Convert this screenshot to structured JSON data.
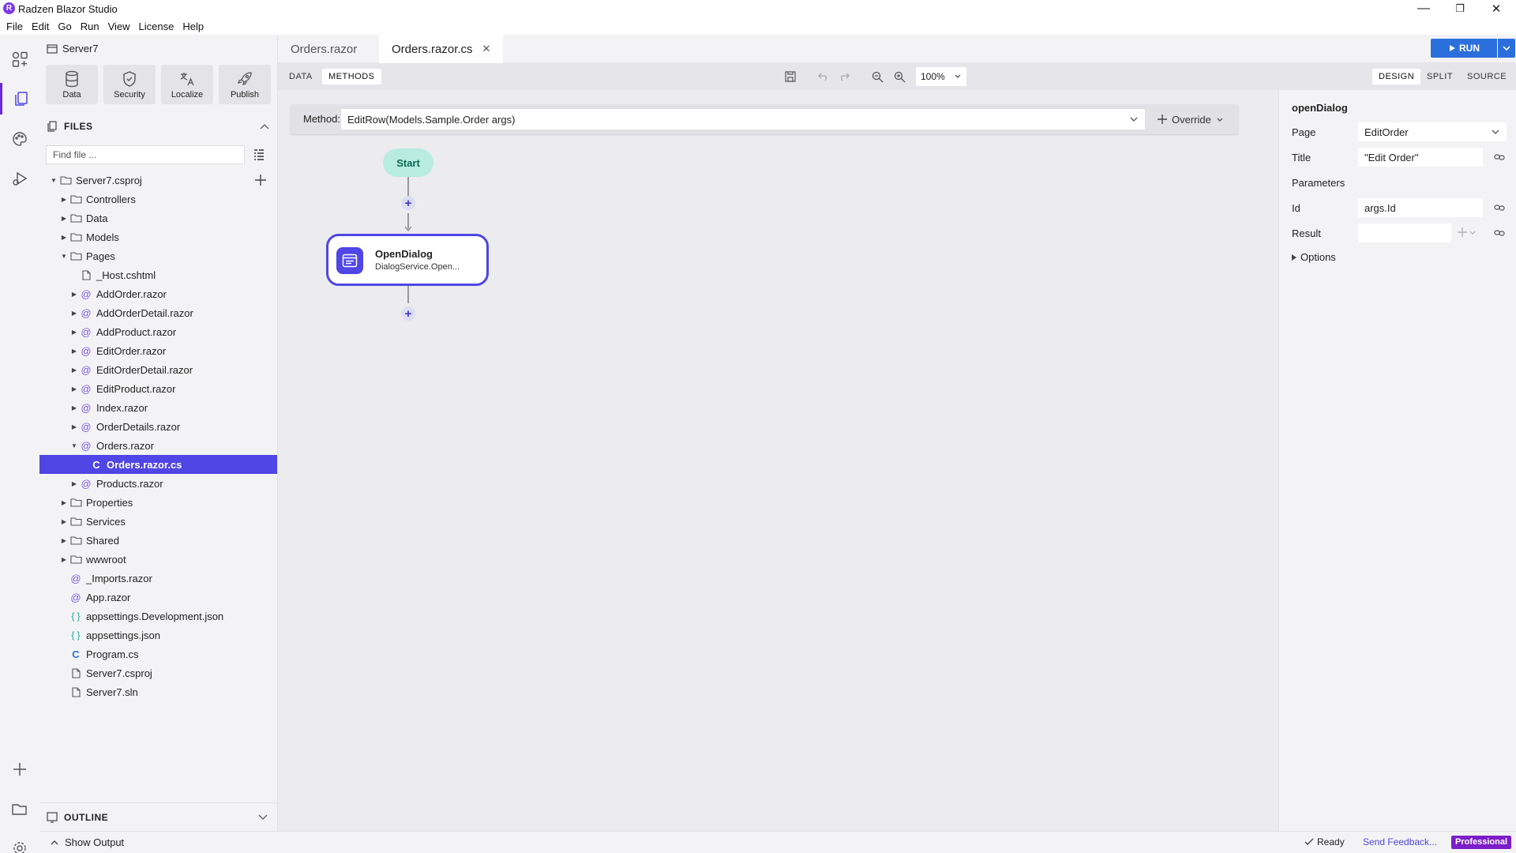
{
  "app": {
    "logo": "R",
    "title": "Radzen Blazor Studio"
  },
  "window_controls": {
    "minimize": "—",
    "restore": "❐",
    "close": "✕"
  },
  "menu": [
    "File",
    "Edit",
    "Go",
    "Run",
    "View",
    "License",
    "Help"
  ],
  "activity_bar": [
    {
      "icon": "components-icon"
    },
    {
      "icon": "files-icon",
      "active": true
    },
    {
      "icon": "palette-icon"
    },
    {
      "icon": "debug-run-icon"
    },
    {
      "icon": "add-icon"
    },
    {
      "icon": "open-folder-icon"
    },
    {
      "icon": "settings-gear-icon"
    }
  ],
  "sidebar": {
    "project_name": "Server7",
    "tools": [
      {
        "label": "Data",
        "icon": "database-icon"
      },
      {
        "label": "Security",
        "icon": "shield-icon"
      },
      {
        "label": "Localize",
        "icon": "translate-icon"
      },
      {
        "label": "Publish",
        "icon": "rocket-icon"
      }
    ],
    "files_heading": "FILES",
    "find_placeholder": "Find file ...",
    "tree": [
      {
        "label": "Server7.csproj",
        "type": "folder",
        "depth": 0,
        "expanded": true
      },
      {
        "label": "Controllers",
        "type": "folder",
        "depth": 1
      },
      {
        "label": "Data",
        "type": "folder",
        "depth": 1
      },
      {
        "label": "Models",
        "type": "folder",
        "depth": 1
      },
      {
        "label": "Pages",
        "type": "folder",
        "depth": 1,
        "expanded": true
      },
      {
        "label": "_Host.cshtml",
        "type": "file-doc",
        "depth": 2
      },
      {
        "label": "AddOrder.razor",
        "type": "razor",
        "depth": 2,
        "collapsible": true
      },
      {
        "label": "AddOrderDetail.razor",
        "type": "razor",
        "depth": 2,
        "collapsible": true
      },
      {
        "label": "AddProduct.razor",
        "type": "razor",
        "depth": 2,
        "collapsible": true
      },
      {
        "label": "EditOrder.razor",
        "type": "razor",
        "depth": 2,
        "collapsible": true
      },
      {
        "label": "EditOrderDetail.razor",
        "type": "razor",
        "depth": 2,
        "collapsible": true
      },
      {
        "label": "EditProduct.razor",
        "type": "razor",
        "depth": 2,
        "collapsible": true
      },
      {
        "label": "Index.razor",
        "type": "razor",
        "depth": 2,
        "collapsible": true
      },
      {
        "label": "OrderDetails.razor",
        "type": "razor",
        "depth": 2,
        "collapsible": true
      },
      {
        "label": "Orders.razor",
        "type": "razor",
        "depth": 2,
        "collapsible": true,
        "expanded": true
      },
      {
        "label": "Orders.razor.cs",
        "type": "csharp",
        "depth": 3,
        "selected": true
      },
      {
        "label": "Products.razor",
        "type": "razor",
        "depth": 2,
        "collapsible": true
      },
      {
        "label": "Properties",
        "type": "folder",
        "depth": 1
      },
      {
        "label": "Services",
        "type": "folder",
        "depth": 1
      },
      {
        "label": "Shared",
        "type": "folder",
        "depth": 1
      },
      {
        "label": "wwwroot",
        "type": "folder",
        "depth": 1
      },
      {
        "label": "_Imports.razor",
        "type": "razor",
        "depth": 1
      },
      {
        "label": "App.razor",
        "type": "razor",
        "depth": 1
      },
      {
        "label": "appsettings.Development.json",
        "type": "json",
        "depth": 1
      },
      {
        "label": "appsettings.json",
        "type": "json",
        "depth": 1
      },
      {
        "label": "Program.cs",
        "type": "csharp",
        "depth": 1
      },
      {
        "label": "Server7.csproj",
        "type": "file-doc",
        "depth": 1
      },
      {
        "label": "Server7.sln",
        "type": "file-doc",
        "depth": 1
      }
    ],
    "outline_heading": "OUTLINE"
  },
  "tabs": [
    {
      "label": "Orders.razor",
      "active": false
    },
    {
      "label": "Orders.razor.cs",
      "active": true,
      "close": "✕"
    }
  ],
  "run": {
    "label": "RUN"
  },
  "toolbar": {
    "left_tabs": [
      {
        "label": "DATA"
      },
      {
        "label": "METHODS",
        "active": true
      }
    ],
    "zoom": "100%",
    "view_modes": [
      {
        "label": "DESIGN",
        "active": true
      },
      {
        "label": "SPLIT"
      },
      {
        "label": "SOURCE"
      }
    ]
  },
  "canvas": {
    "method_label": "Method:",
    "method_value": "EditRow(Models.Sample.Order args)",
    "override_label": "Override",
    "start_label": "Start",
    "add_symbol": "+",
    "action": {
      "title": "OpenDialog",
      "subtitle": "DialogService.Open..."
    }
  },
  "properties": {
    "title": "openDialog",
    "page_label": "Page",
    "page_value": "EditOrder",
    "title_label": "Title",
    "title_value": "\"Edit Order\"",
    "parameters_label": "Parameters",
    "id_label": "Id",
    "id_value": "args.Id",
    "result_label": "Result",
    "result_value": "",
    "options_label": "Options"
  },
  "status": {
    "show_output": "Show Output",
    "ready": "Ready",
    "feedback": "Send Feedback...",
    "edition": "Professional"
  },
  "colors": {
    "accent": "#4f46e5",
    "run": "#2a6fdb",
    "start": "#b8ece0",
    "edition": "#7c1dc9"
  }
}
